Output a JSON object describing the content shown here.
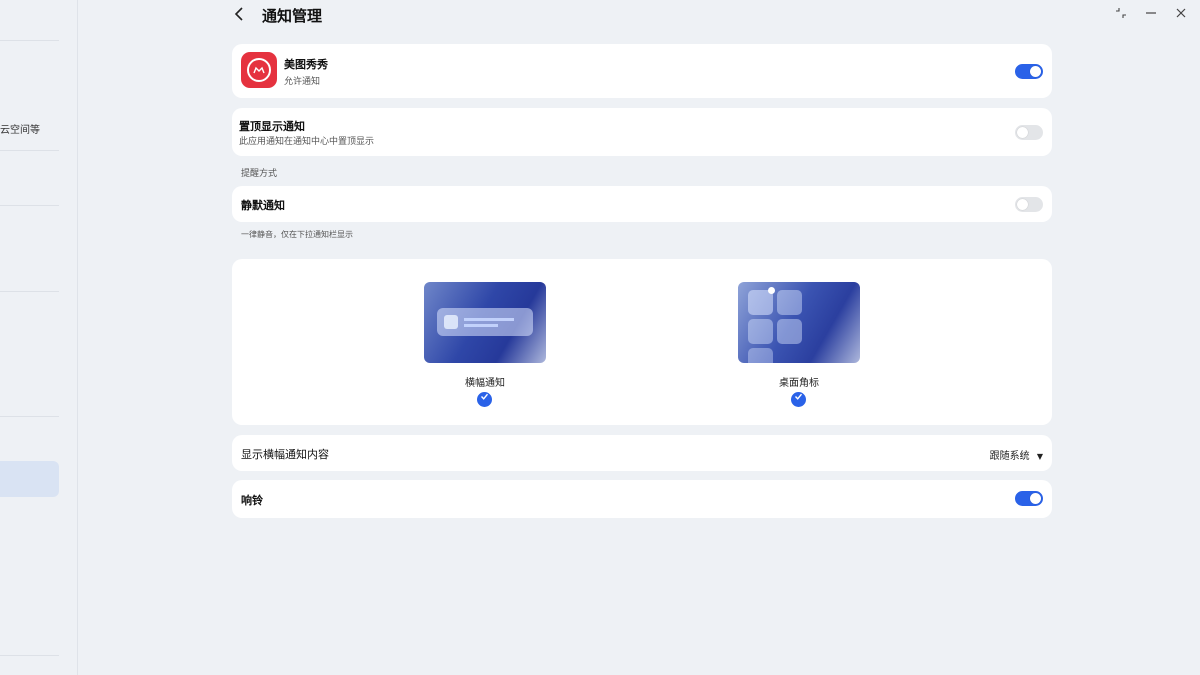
{
  "sidebar": {
    "partial_label": "云空间等"
  },
  "header": {
    "back_icon": "chevron-left-icon",
    "title": "通知管理"
  },
  "window_controls": {
    "restore_icon": "restore-icon",
    "minimize_icon": "minimize-icon",
    "close_icon": "close-icon"
  },
  "app_card": {
    "app_name": "美图秀秀",
    "subtitle": "允许通知",
    "allow_notifications": true
  },
  "pin_card": {
    "title": "置顶显示通知",
    "subtitle": "此应用通知在通知中心中置顶显示",
    "enabled": false
  },
  "alert_section": {
    "label": "提醒方式"
  },
  "silent_card": {
    "title": "静默通知",
    "enabled": false
  },
  "silent_hint": "一律静音，仅在下拉通知栏显示",
  "styles": {
    "banner_label": "横幅通知",
    "banner_checked": true,
    "badge_label": "桌面角标",
    "badge_checked": true
  },
  "banner_content": {
    "title": "显示横幅通知内容",
    "value": "跟随系统"
  },
  "ring_card": {
    "title": "响铃",
    "enabled": true
  },
  "colors": {
    "accent": "#2a62e8",
    "app_icon": "#e5323f",
    "background": "#eef1f5"
  }
}
